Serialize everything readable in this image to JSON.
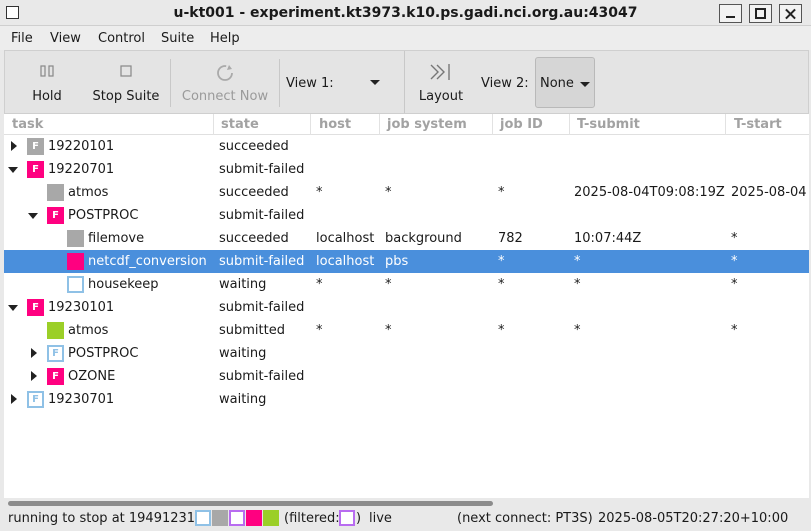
{
  "window": {
    "title": "u-kt001 - experiment.kt3973.k10.ps.gadi.nci.org.au:43047"
  },
  "menu": [
    "File",
    "View",
    "Control",
    "Suite",
    "Help"
  ],
  "toolbar": {
    "hold": "Hold",
    "stop_suite": "Stop Suite",
    "connect_now": "Connect Now",
    "view1_label": "View 1:",
    "layout": "Layout",
    "view2_label": "View 2:",
    "view2_value": "None"
  },
  "columns": [
    "task",
    "state",
    "host",
    "job system",
    "job ID",
    "T-submit",
    "T-start"
  ],
  "colors": {
    "succeeded": "#a8a8a8",
    "submit_failed": "#ff0080",
    "waiting": "#8fc1e6",
    "submitted": "#9bcf27",
    "selection": "#4a8fdc",
    "filtered": "#b86cf0"
  },
  "rows": [
    {
      "task": "19220101",
      "state": "succeeded",
      "host": "",
      "job_system": "",
      "job_id": "",
      "t_submit": "",
      "t_start": ""
    },
    {
      "task": "19220701",
      "state": "submit-failed",
      "host": "",
      "job_system": "",
      "job_id": "",
      "t_submit": "",
      "t_start": ""
    },
    {
      "task": "atmos",
      "state": "succeeded",
      "host": "*",
      "job_system": "*",
      "job_id": "*",
      "t_submit": "2025-08-04T09:08:19Z",
      "t_start": "2025-08-04"
    },
    {
      "task": "POSTPROC",
      "state": "submit-failed",
      "host": "",
      "job_system": "",
      "job_id": "",
      "t_submit": "",
      "t_start": ""
    },
    {
      "task": "filemove",
      "state": "succeeded",
      "host": "localhost",
      "job_system": "background",
      "job_id": "782",
      "t_submit": "10:07:44Z",
      "t_start": "*"
    },
    {
      "task": "netcdf_conversion",
      "state": "submit-failed",
      "host": "localhost",
      "job_system": "pbs",
      "job_id": "*",
      "t_submit": "*",
      "t_start": "*"
    },
    {
      "task": "housekeep",
      "state": "waiting",
      "host": "*",
      "job_system": "*",
      "job_id": "*",
      "t_submit": "*",
      "t_start": "*"
    },
    {
      "task": "19230101",
      "state": "submit-failed",
      "host": "",
      "job_system": "",
      "job_id": "",
      "t_submit": "",
      "t_start": ""
    },
    {
      "task": "atmos",
      "state": "submitted",
      "host": "*",
      "job_system": "*",
      "job_id": "*",
      "t_submit": "*",
      "t_start": "*"
    },
    {
      "task": "POSTPROC",
      "state": "waiting",
      "host": "",
      "job_system": "",
      "job_id": "",
      "t_submit": "",
      "t_start": ""
    },
    {
      "task": "OZONE",
      "state": "submit-failed",
      "host": "",
      "job_system": "",
      "job_id": "",
      "t_submit": "",
      "t_start": ""
    },
    {
      "task": "19230701",
      "state": "waiting",
      "host": "",
      "job_system": "",
      "job_id": "",
      "t_submit": "",
      "t_start": ""
    }
  ],
  "status": {
    "run_text": "running to stop at 19491231",
    "filtered_open": "(filtered:",
    "filtered_close": ")",
    "live": "live",
    "next_connect": "(next connect: PT3S)",
    "timestamp": "2025-08-05T20:27:20+10:00"
  }
}
